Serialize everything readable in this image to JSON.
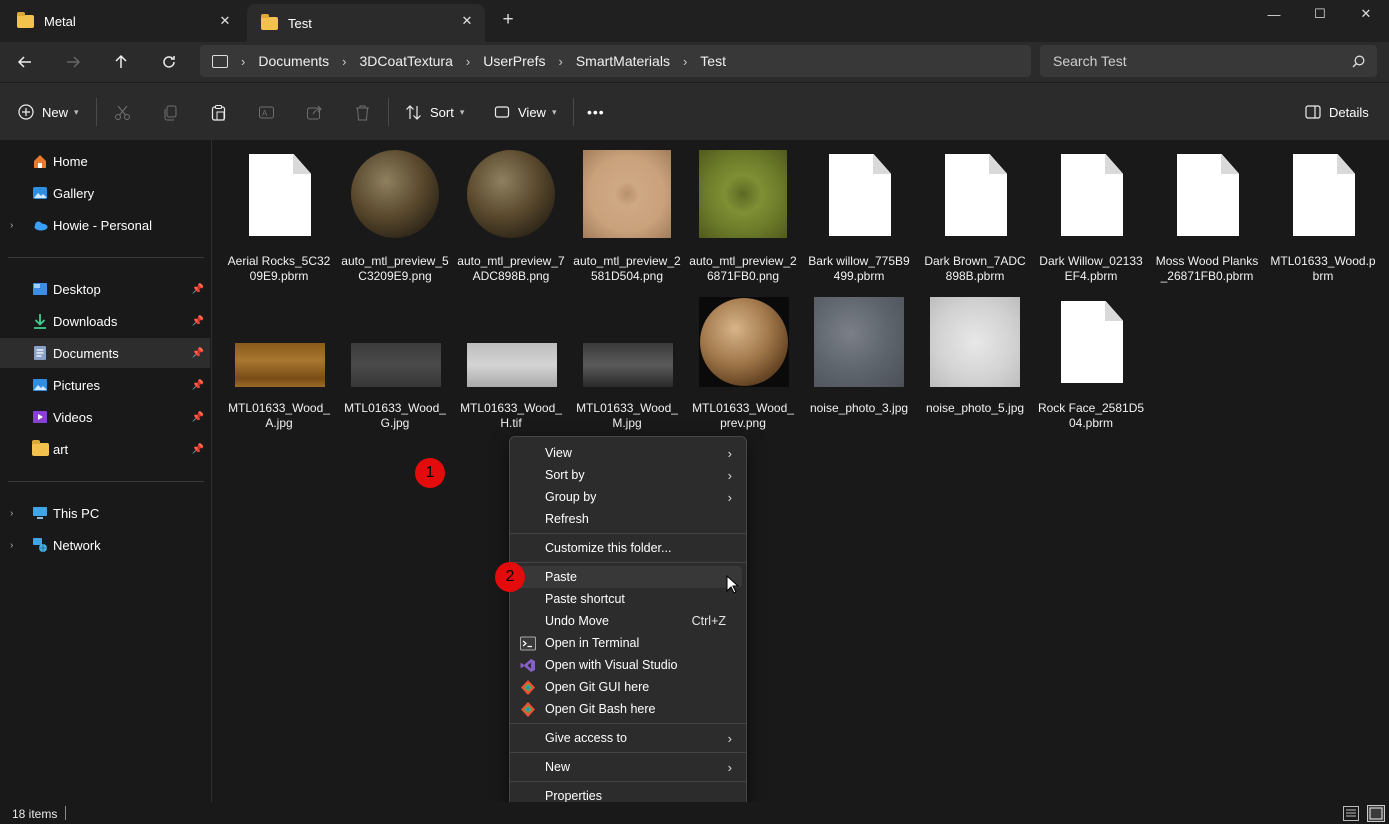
{
  "tabs": [
    {
      "label": "Metal",
      "close": "✕"
    },
    {
      "label": "Test",
      "close": "✕"
    }
  ],
  "window_controls": {
    "minimize": "—",
    "maximize": "☐",
    "close": "✕",
    "new_tab": "+"
  },
  "address": {
    "crumbs": [
      "Documents",
      "3DCoatTextura",
      "UserPrefs",
      "SmartMaterials",
      "Test"
    ]
  },
  "search": {
    "placeholder": "Search Test"
  },
  "toolbar": {
    "new_label": "New",
    "sort_label": "Sort",
    "view_label": "View",
    "more_label": "•••",
    "details_label": "Details"
  },
  "sidebar": {
    "home": "Home",
    "gallery": "Gallery",
    "onedrive": "Howie - Personal",
    "desktop": "Desktop",
    "downloads": "Downloads",
    "documents": "Documents",
    "pictures": "Pictures",
    "videos": "Videos",
    "art": "art",
    "thispc": "This PC",
    "network": "Network"
  },
  "files": [
    {
      "name": "Aerial Rocks_5C3209E9.pbrm",
      "kind": "doc"
    },
    {
      "name": "auto_mtl_preview_5C3209E9.png",
      "kind": "sphere1"
    },
    {
      "name": "auto_mtl_preview_7ADC898B.png",
      "kind": "sphere1"
    },
    {
      "name": "auto_mtl_preview_2581D504.png",
      "kind": "sand"
    },
    {
      "name": "auto_mtl_preview_26871FB0.png",
      "kind": "moss"
    },
    {
      "name": "Bark willow_775B9499.pbrm",
      "kind": "doc"
    },
    {
      "name": "Dark Brown_7ADC898B.pbrm",
      "kind": "doc"
    },
    {
      "name": "Dark Willow_02133EF4.pbrm",
      "kind": "doc"
    },
    {
      "name": "Moss Wood Planks_26871FB0.pbrm",
      "kind": "doc"
    },
    {
      "name": "MTL01633_Wood.pbrm",
      "kind": "doc"
    },
    {
      "name": "MTL01633_Wood_A.jpg",
      "kind": "woodA"
    },
    {
      "name": "MTL01633_Wood_G.jpg",
      "kind": "woodG"
    },
    {
      "name": "MTL01633_Wood_H.tif",
      "kind": "woodH"
    },
    {
      "name": "MTL01633_Wood_M.jpg",
      "kind": "woodM"
    },
    {
      "name": "MTL01633_Wood_prev.png",
      "kind": "sphere2"
    },
    {
      "name": "noise_photo_3.jpg",
      "kind": "noise3"
    },
    {
      "name": "noise_photo_5.jpg",
      "kind": "noise5"
    },
    {
      "name": "Rock Face_2581D504.pbrm",
      "kind": "doc"
    }
  ],
  "context_menu": {
    "view": "View",
    "sort_by": "Sort by",
    "group_by": "Group by",
    "refresh": "Refresh",
    "customize": "Customize this folder...",
    "paste": "Paste",
    "paste_shortcut": "Paste shortcut",
    "undo_move": "Undo Move",
    "undo_key": "Ctrl+Z",
    "terminal": "Open in Terminal",
    "visual_studio": "Open with Visual Studio",
    "git_gui": "Open Git GUI here",
    "git_bash": "Open Git Bash here",
    "give_access": "Give access to",
    "new": "New",
    "properties": "Properties"
  },
  "annotations": {
    "badge1": "1",
    "badge2": "2"
  },
  "status": {
    "items": "18 items"
  },
  "colors": {
    "badge": "#e30b0b",
    "folder": "#f2c14e",
    "accent": "#4aa3ff"
  }
}
